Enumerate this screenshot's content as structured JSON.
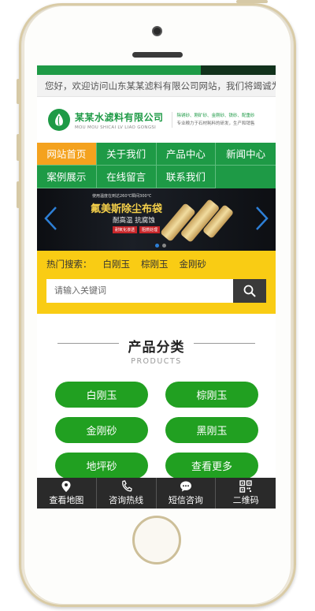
{
  "welcome_text": "您好，欢迎访问山东某某滤料有限公司网站，我们将竭诚为",
  "logo": {
    "name_cn": "某某水滤料有限公司",
    "name_en": "MOU MOU SHICAI LV LIAO GONGSI",
    "tagline_line1": "除锈砂、刚矿砂、金刚砂、铁砂、配重砂",
    "tagline_line2": "专业粮力于石材耗料的研发，生产和销售"
  },
  "nav": {
    "items": [
      {
        "label": "网站首页",
        "active": true
      },
      {
        "label": "关于我们",
        "active": false
      },
      {
        "label": "产品中心",
        "active": false
      },
      {
        "label": "新闻中心",
        "active": false
      },
      {
        "label": "案例展示",
        "active": false
      },
      {
        "label": "在线留言",
        "active": false
      },
      {
        "label": "联系我们",
        "active": false
      }
    ]
  },
  "banner": {
    "small_text": "使用温度在到达260℃瞬间300℃",
    "title": "氟美斯除尘布袋",
    "subtitle": "耐高温 抗腐蚀",
    "tags": [
      "耐氧化渗透",
      "阻燃处理"
    ],
    "prev_icon": "chevron-left-icon",
    "next_icon": "chevron-right-icon",
    "slide_count": 2,
    "active_slide": 1
  },
  "search": {
    "hot_label": "热门搜索：",
    "keywords": [
      "白刚玉",
      "棕刚玉",
      "金刚砂"
    ],
    "placeholder": "请输入关键词",
    "icon": "search-icon"
  },
  "products_section": {
    "title_cn": "产品分类",
    "title_en": "PRODUCTS",
    "categories": [
      "白刚玉",
      "棕刚玉",
      "金刚砂",
      "黑刚玉",
      "地坪砂",
      "查看更多"
    ]
  },
  "bottom_bar": [
    {
      "label": "查看地图",
      "icon": "map-pin-icon"
    },
    {
      "label": "咨询热线",
      "icon": "phone-icon"
    },
    {
      "label": "短信咨询",
      "icon": "message-icon"
    },
    {
      "label": "二维码",
      "icon": "qrcode-icon"
    }
  ],
  "colors": {
    "brand_green": "#1e9a46",
    "active_orange": "#f4a21e",
    "search_yellow": "#f9cc14",
    "category_green": "#21a021",
    "bottom_bar": "#2a2a2a"
  }
}
